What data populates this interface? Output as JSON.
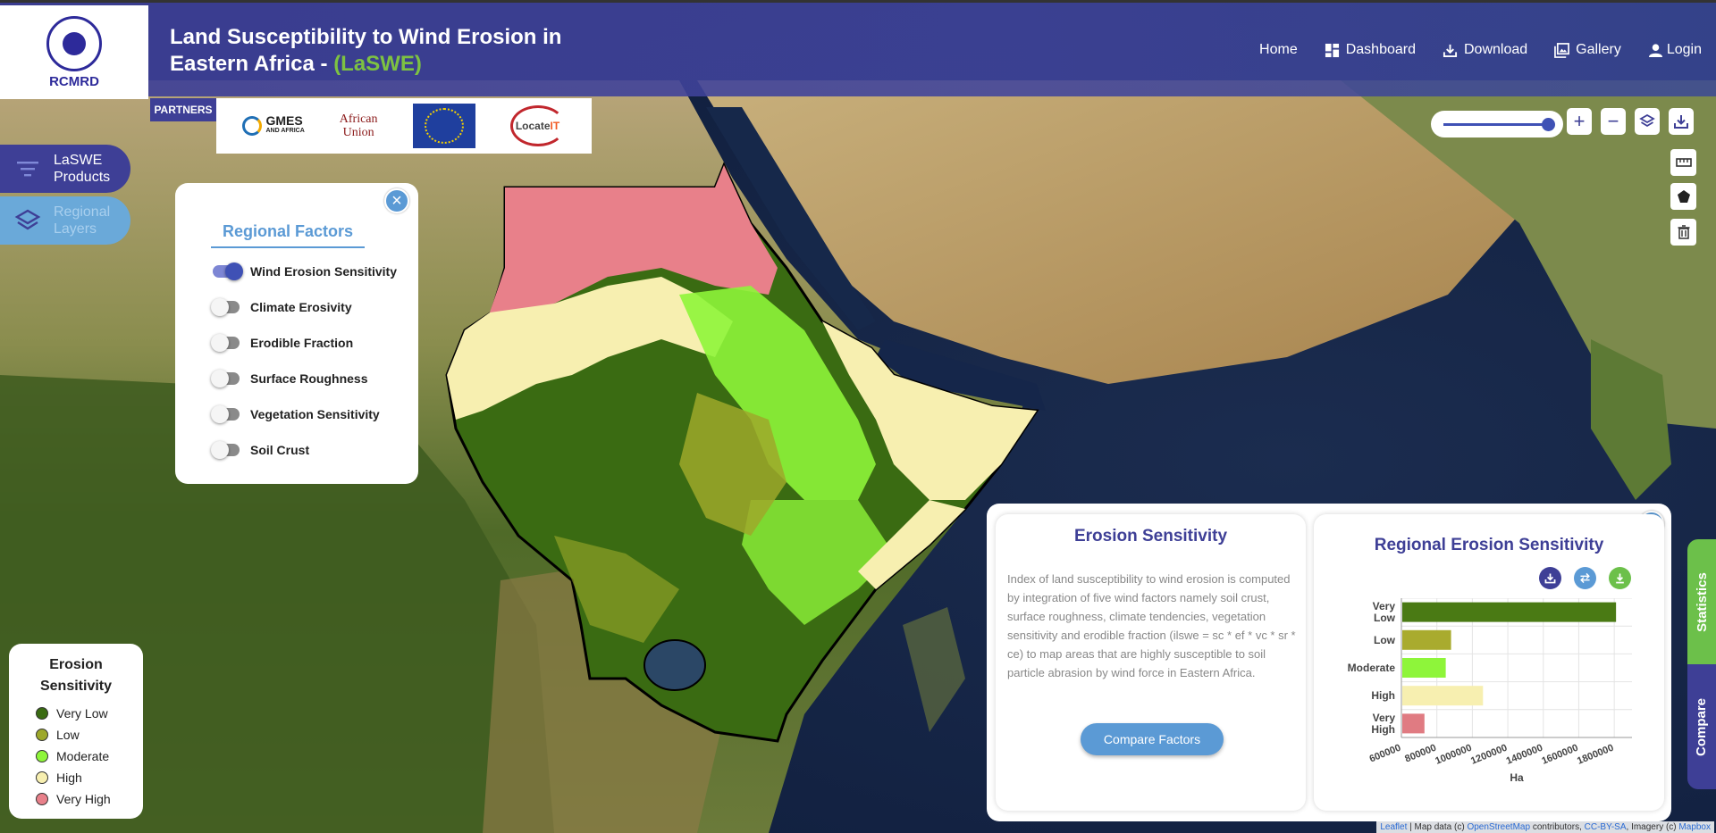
{
  "header": {
    "logo_text": "RCMRD",
    "title": "Land Susceptibility to Wind Erosion in Eastern Africa - ",
    "title_accent": "(LaSWE)",
    "nav": {
      "home": "Home",
      "dashboard": "Dashboard",
      "download": "Download",
      "gallery": "Gallery",
      "login": "Login"
    }
  },
  "partners": {
    "label": "PARTNERS",
    "gmes": "GMES",
    "gmes_sub": "AND AFRICA",
    "au_line1": "African",
    "au_line2": "Union",
    "locate": "Locate",
    "locate_it": "IT"
  },
  "sidebar": {
    "products_label_1": "LaSWE",
    "products_label_2": "Products",
    "layers_label_1": "Regional",
    "layers_label_2": "Layers"
  },
  "factors": {
    "title": "Regional Factors",
    "close": "×",
    "items": [
      {
        "label": "Wind Erosion Sensitivity",
        "on": true
      },
      {
        "label": "Climate Erosivity",
        "on": false
      },
      {
        "label": "Erodible Fraction",
        "on": false
      },
      {
        "label": "Surface Roughness",
        "on": false
      },
      {
        "label": "Vegetation Sensitivity",
        "on": false
      },
      {
        "label": "Soil Crust",
        "on": false
      }
    ]
  },
  "legend": {
    "title_1": "Erosion",
    "title_2": "Sensitivity",
    "items": [
      {
        "label": "Very Low",
        "color": "#3a6b12"
      },
      {
        "label": "Low",
        "color": "#9da82a"
      },
      {
        "label": "Moderate",
        "color": "#8ef53a"
      },
      {
        "label": "High",
        "color": "#f7efb0"
      },
      {
        "label": "Very High",
        "color": "#e8808a"
      }
    ]
  },
  "map_controls": {
    "zoom_in": "+",
    "zoom_out": "−"
  },
  "stats": {
    "close": "×",
    "desc_title": "Erosion Sensitivity",
    "desc_text": "Index of land susceptibility to wind erosion is computed by integration of five wind factors namely soil crust, surface roughness, climate tendencies, vegetation sensitivity and erodible fraction (ilswe = sc * ef * vc * sr * ce) to map areas that are highly susceptible to soil particle abrasion by wind force in Eastern Africa.",
    "compare_button": "Compare Factors",
    "chart_title": "Regional Erosion Sensitivity"
  },
  "chart_data": {
    "type": "bar",
    "orientation": "horizontal",
    "title": "Regional Erosion Sensitivity",
    "xlabel": "Ha",
    "ylabel": "",
    "categories": [
      "Very Low",
      "Low",
      "Moderate",
      "High",
      "Very High"
    ],
    "category_lines": [
      [
        "Very",
        "Low"
      ],
      [
        "Low"
      ],
      [
        "Moderate"
      ],
      [
        "High"
      ],
      [
        "Very",
        "High"
      ]
    ],
    "values": [
      1810000,
      880000,
      850000,
      1060000,
      730000
    ],
    "colors": [
      "#4a7a14",
      "#a9ab2e",
      "#8ef53a",
      "#f7efb0",
      "#e07b82"
    ],
    "xlim": [
      600000,
      1900000
    ],
    "xticks": [
      600000,
      800000,
      1000000,
      1200000,
      1400000,
      1600000,
      1800000
    ],
    "xtick_labels": [
      "600000",
      "800000",
      "1000000",
      "1200000",
      "1400000",
      "1600000",
      "1800000"
    ],
    "grid": true
  },
  "tabs": {
    "statistics": "Statistics",
    "compare": "Compare"
  },
  "attribution": {
    "leaflet": "Leaflet",
    "text1": " | Map data (c) ",
    "osm": "OpenStreetMap",
    "text2": " contributors, ",
    "license": "CC-BY-SA",
    "text3": ", Imagery (c) ",
    "mapbox": "Mapbox"
  }
}
